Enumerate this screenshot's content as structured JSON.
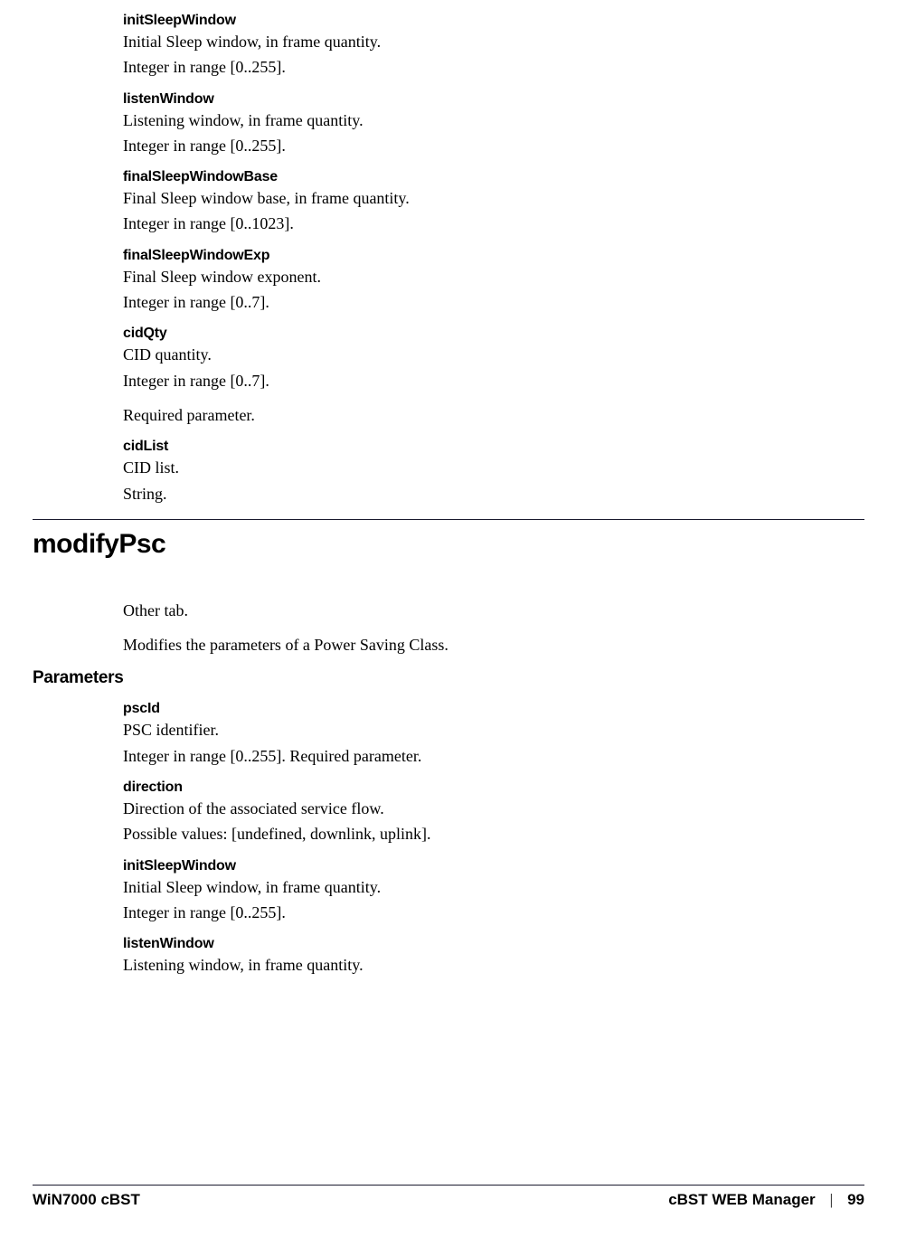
{
  "top_params": [
    {
      "name": "initSleepWindow",
      "paragraphs": [
        "Initial Sleep window, in frame quantity.",
        "Integer in range [0..255]."
      ]
    },
    {
      "name": "listenWindow",
      "paragraphs": [
        "Listening window, in frame quantity.",
        "Integer in range [0..255]."
      ]
    },
    {
      "name": "finalSleepWindowBase",
      "paragraphs": [
        "Final Sleep window base, in frame quantity.",
        "Integer in range [0..1023]."
      ]
    },
    {
      "name": "finalSleepWindowExp",
      "paragraphs": [
        "Final Sleep window exponent.",
        "Integer in range [0..7]."
      ]
    },
    {
      "name": "cidQty",
      "paragraphs": [
        "CID quantity.",
        "Integer in range [0..7].",
        "Required parameter."
      ]
    },
    {
      "name": "cidList",
      "paragraphs": [
        "CID list.",
        "String."
      ]
    }
  ],
  "section_heading": "modifyPsc",
  "section_intro": [
    "Other tab.",
    "Modifies the parameters of a Power Saving Class."
  ],
  "subhead_parameters": "Parameters",
  "bottom_params": [
    {
      "name": "pscId",
      "paragraphs": [
        "PSC identifier.",
        "Integer in range [0..255]. Required parameter."
      ]
    },
    {
      "name": "direction",
      "paragraphs": [
        "Direction of the associated service flow.",
        "Possible values: [undefined, downlink, uplink]."
      ]
    },
    {
      "name": "initSleepWindow",
      "paragraphs": [
        "Initial Sleep window, in frame quantity.",
        "Integer in range [0..255]."
      ]
    },
    {
      "name": "listenWindow",
      "paragraphs": [
        "Listening window, in frame quantity."
      ]
    }
  ],
  "footer": {
    "left": "WiN7000 cBST",
    "right_label": "cBST WEB Manager",
    "separator": "|",
    "page": "99"
  }
}
